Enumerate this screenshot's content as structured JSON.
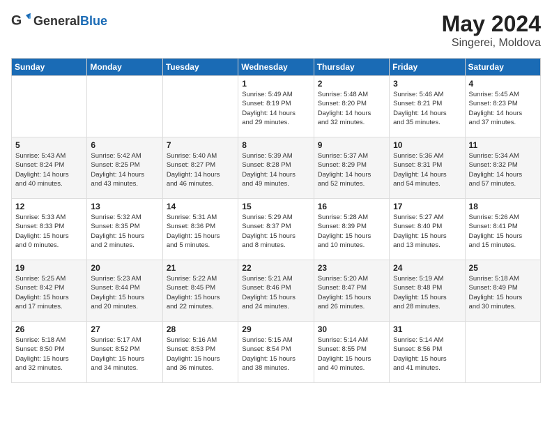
{
  "header": {
    "logo_general": "General",
    "logo_blue": "Blue",
    "month_year": "May 2024",
    "location": "Singerei, Moldova"
  },
  "days_of_week": [
    "Sunday",
    "Monday",
    "Tuesday",
    "Wednesday",
    "Thursday",
    "Friday",
    "Saturday"
  ],
  "weeks": [
    [
      {
        "day": "",
        "info": ""
      },
      {
        "day": "",
        "info": ""
      },
      {
        "day": "",
        "info": ""
      },
      {
        "day": "1",
        "info": "Sunrise: 5:49 AM\nSunset: 8:19 PM\nDaylight: 14 hours\nand 29 minutes."
      },
      {
        "day": "2",
        "info": "Sunrise: 5:48 AM\nSunset: 8:20 PM\nDaylight: 14 hours\nand 32 minutes."
      },
      {
        "day": "3",
        "info": "Sunrise: 5:46 AM\nSunset: 8:21 PM\nDaylight: 14 hours\nand 35 minutes."
      },
      {
        "day": "4",
        "info": "Sunrise: 5:45 AM\nSunset: 8:23 PM\nDaylight: 14 hours\nand 37 minutes."
      }
    ],
    [
      {
        "day": "5",
        "info": "Sunrise: 5:43 AM\nSunset: 8:24 PM\nDaylight: 14 hours\nand 40 minutes."
      },
      {
        "day": "6",
        "info": "Sunrise: 5:42 AM\nSunset: 8:25 PM\nDaylight: 14 hours\nand 43 minutes."
      },
      {
        "day": "7",
        "info": "Sunrise: 5:40 AM\nSunset: 8:27 PM\nDaylight: 14 hours\nand 46 minutes."
      },
      {
        "day": "8",
        "info": "Sunrise: 5:39 AM\nSunset: 8:28 PM\nDaylight: 14 hours\nand 49 minutes."
      },
      {
        "day": "9",
        "info": "Sunrise: 5:37 AM\nSunset: 8:29 PM\nDaylight: 14 hours\nand 52 minutes."
      },
      {
        "day": "10",
        "info": "Sunrise: 5:36 AM\nSunset: 8:31 PM\nDaylight: 14 hours\nand 54 minutes."
      },
      {
        "day": "11",
        "info": "Sunrise: 5:34 AM\nSunset: 8:32 PM\nDaylight: 14 hours\nand 57 minutes."
      }
    ],
    [
      {
        "day": "12",
        "info": "Sunrise: 5:33 AM\nSunset: 8:33 PM\nDaylight: 15 hours\nand 0 minutes."
      },
      {
        "day": "13",
        "info": "Sunrise: 5:32 AM\nSunset: 8:35 PM\nDaylight: 15 hours\nand 2 minutes."
      },
      {
        "day": "14",
        "info": "Sunrise: 5:31 AM\nSunset: 8:36 PM\nDaylight: 15 hours\nand 5 minutes."
      },
      {
        "day": "15",
        "info": "Sunrise: 5:29 AM\nSunset: 8:37 PM\nDaylight: 15 hours\nand 8 minutes."
      },
      {
        "day": "16",
        "info": "Sunrise: 5:28 AM\nSunset: 8:39 PM\nDaylight: 15 hours\nand 10 minutes."
      },
      {
        "day": "17",
        "info": "Sunrise: 5:27 AM\nSunset: 8:40 PM\nDaylight: 15 hours\nand 13 minutes."
      },
      {
        "day": "18",
        "info": "Sunrise: 5:26 AM\nSunset: 8:41 PM\nDaylight: 15 hours\nand 15 minutes."
      }
    ],
    [
      {
        "day": "19",
        "info": "Sunrise: 5:25 AM\nSunset: 8:42 PM\nDaylight: 15 hours\nand 17 minutes."
      },
      {
        "day": "20",
        "info": "Sunrise: 5:23 AM\nSunset: 8:44 PM\nDaylight: 15 hours\nand 20 minutes."
      },
      {
        "day": "21",
        "info": "Sunrise: 5:22 AM\nSunset: 8:45 PM\nDaylight: 15 hours\nand 22 minutes."
      },
      {
        "day": "22",
        "info": "Sunrise: 5:21 AM\nSunset: 8:46 PM\nDaylight: 15 hours\nand 24 minutes."
      },
      {
        "day": "23",
        "info": "Sunrise: 5:20 AM\nSunset: 8:47 PM\nDaylight: 15 hours\nand 26 minutes."
      },
      {
        "day": "24",
        "info": "Sunrise: 5:19 AM\nSunset: 8:48 PM\nDaylight: 15 hours\nand 28 minutes."
      },
      {
        "day": "25",
        "info": "Sunrise: 5:18 AM\nSunset: 8:49 PM\nDaylight: 15 hours\nand 30 minutes."
      }
    ],
    [
      {
        "day": "26",
        "info": "Sunrise: 5:18 AM\nSunset: 8:50 PM\nDaylight: 15 hours\nand 32 minutes."
      },
      {
        "day": "27",
        "info": "Sunrise: 5:17 AM\nSunset: 8:52 PM\nDaylight: 15 hours\nand 34 minutes."
      },
      {
        "day": "28",
        "info": "Sunrise: 5:16 AM\nSunset: 8:53 PM\nDaylight: 15 hours\nand 36 minutes."
      },
      {
        "day": "29",
        "info": "Sunrise: 5:15 AM\nSunset: 8:54 PM\nDaylight: 15 hours\nand 38 minutes."
      },
      {
        "day": "30",
        "info": "Sunrise: 5:14 AM\nSunset: 8:55 PM\nDaylight: 15 hours\nand 40 minutes."
      },
      {
        "day": "31",
        "info": "Sunrise: 5:14 AM\nSunset: 8:56 PM\nDaylight: 15 hours\nand 41 minutes."
      },
      {
        "day": "",
        "info": ""
      }
    ]
  ]
}
